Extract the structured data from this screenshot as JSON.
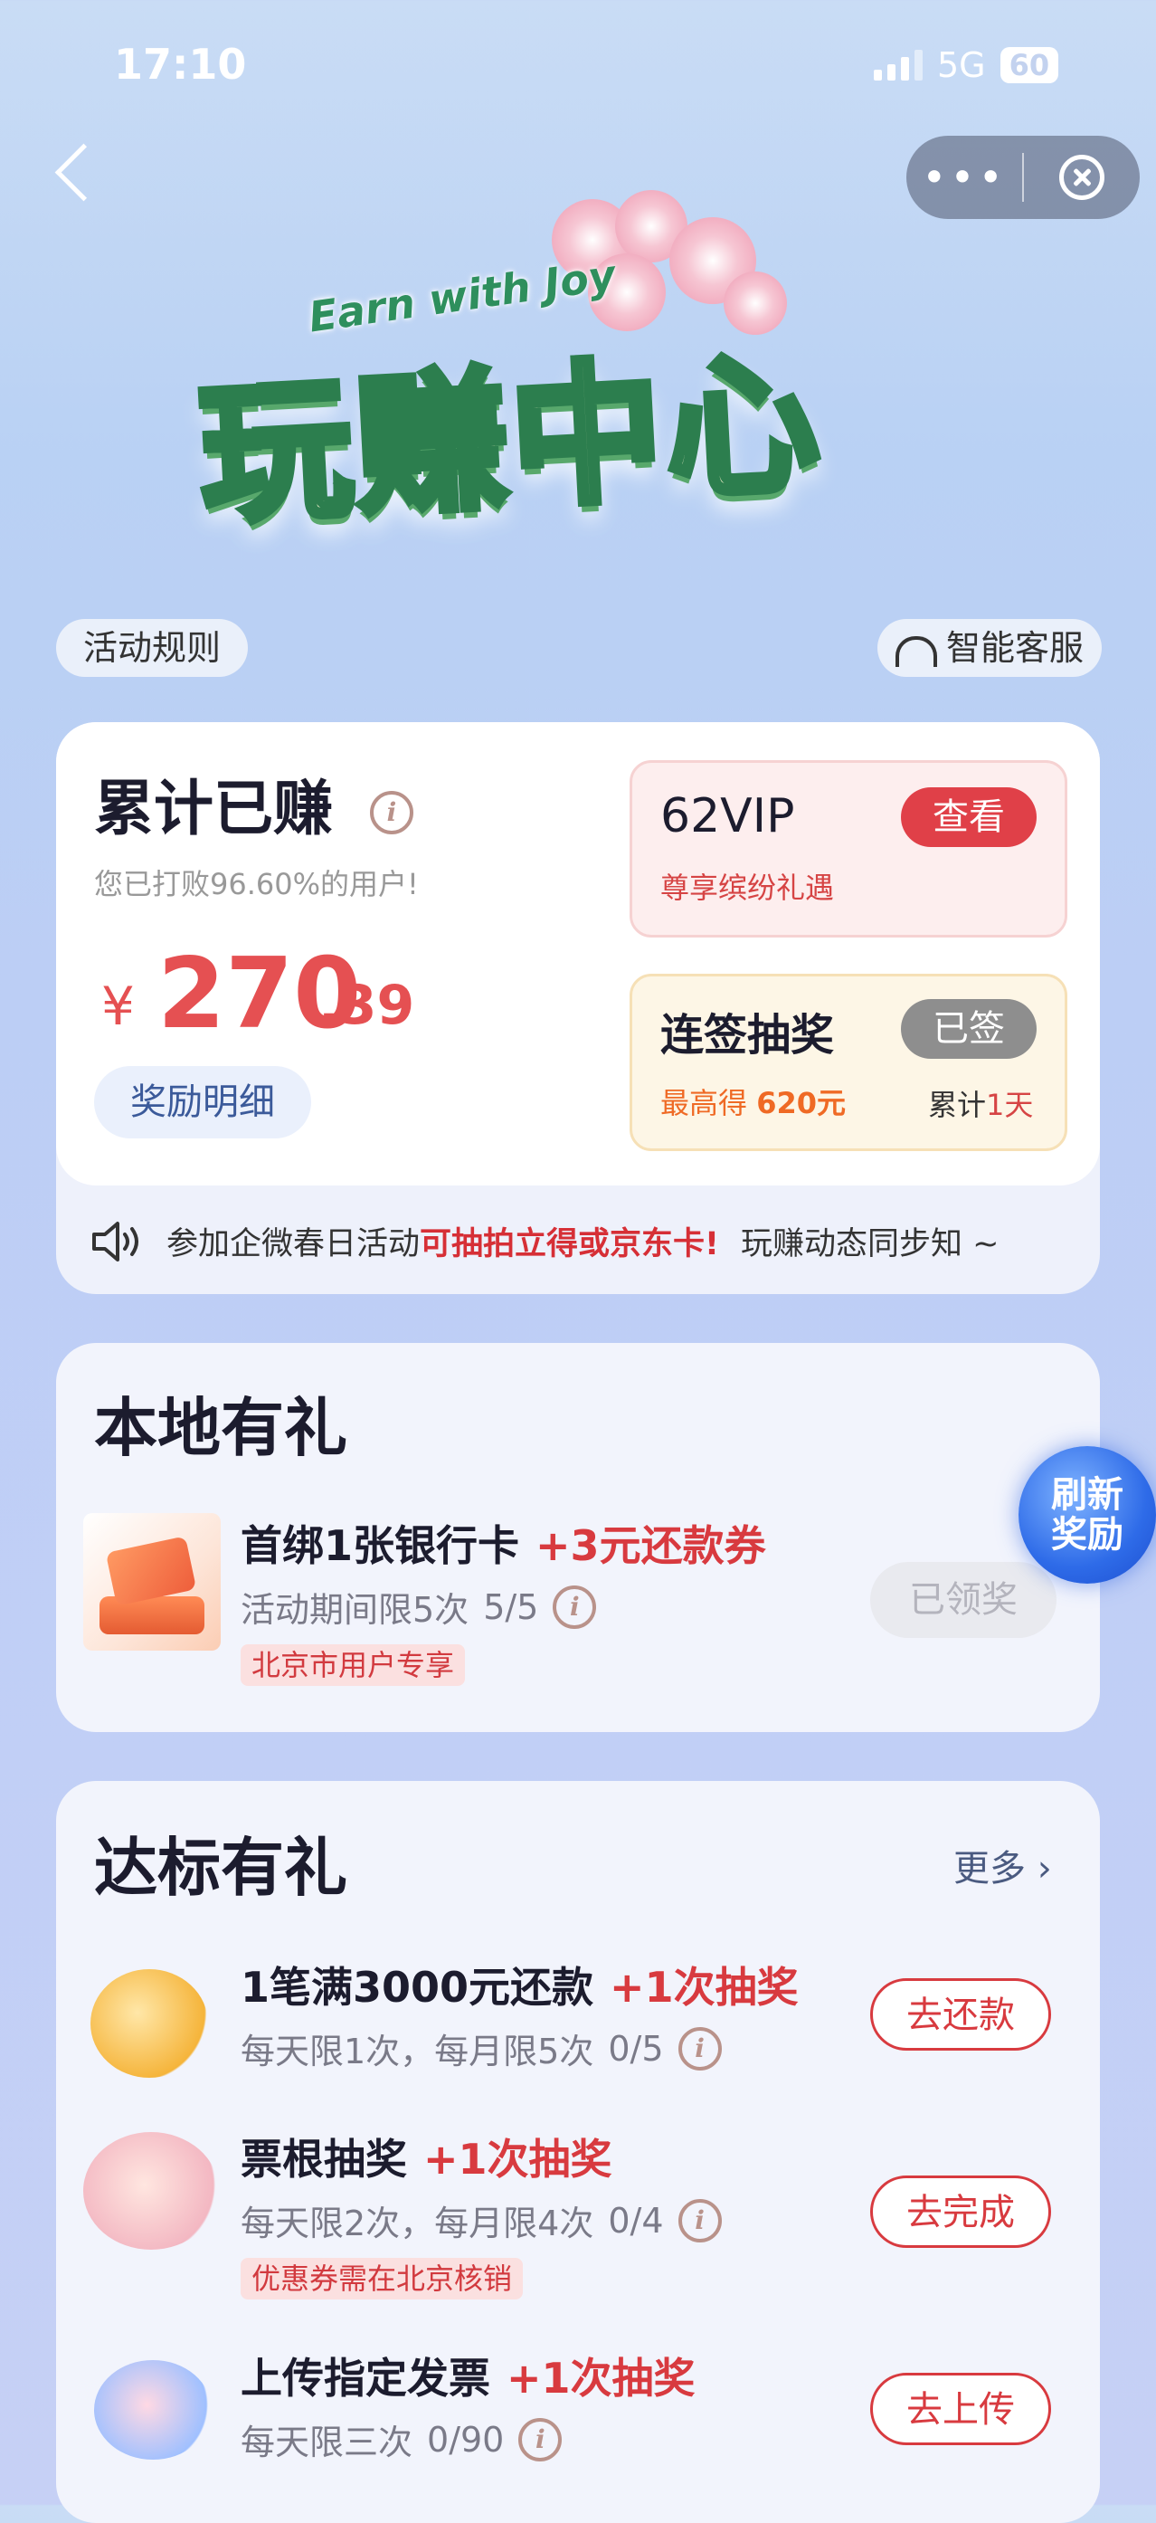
{
  "status": {
    "time": "17:10",
    "network": "5G",
    "battery": "60"
  },
  "hero": {
    "subtitle": "Earn with Joy",
    "title": "玩赚中心"
  },
  "top": {
    "rules": "活动规则",
    "service": "智能客服"
  },
  "summary": {
    "title": "累计已赚",
    "subtitle": "您已打败96.60%的用户!",
    "currency": "¥",
    "amount_int": "270",
    "amount_dec": ".39",
    "detail_button": "奖励明细"
  },
  "vip": {
    "title": "62VIP",
    "subtitle": "尊享缤纷礼遇",
    "button": "查看"
  },
  "signin": {
    "title": "连签抽奖",
    "subtitle_prefix": "最高得",
    "subtitle_value": "620元",
    "button": "已签",
    "days_prefix": "累计",
    "days_value": "1天"
  },
  "notice": {
    "text_a": "参加企微春日活动",
    "text_highlight": "可抽拍立得或京东卡!",
    "text_b": "玩赚动态同步知 ~"
  },
  "local": {
    "title": "本地有礼",
    "item": {
      "title": "首绑1张银行卡",
      "reward": "+3元还款券",
      "limit": "活动期间限5次",
      "progress": "5/5",
      "tag": "北京市用户专享",
      "button": "已领奖"
    },
    "refresh": "刷新\n奖励"
  },
  "tasks": {
    "title": "达标有礼",
    "more": "更多 ›",
    "items": [
      {
        "title": "1笔满3000元还款",
        "reward": "+1次抽奖",
        "limit": "每天限1次，每月限5次",
        "progress": "0/5",
        "tag": "",
        "button": "去还款"
      },
      {
        "title": "票根抽奖",
        "reward": "+1次抽奖",
        "limit": "每天限2次，每月限4次",
        "progress": "0/4",
        "tag": "优惠券需在北京核销",
        "button": "去完成"
      },
      {
        "title": "上传指定发票",
        "reward": "+1次抽奖",
        "limit": "每天限三次",
        "progress": "0/90",
        "tag": "",
        "button": "去上传"
      }
    ]
  },
  "colors": {
    "accent_red": "#d83a3f",
    "amount_red": "#e55052",
    "orange": "#ef6a25",
    "blue": "#2e6be8"
  }
}
